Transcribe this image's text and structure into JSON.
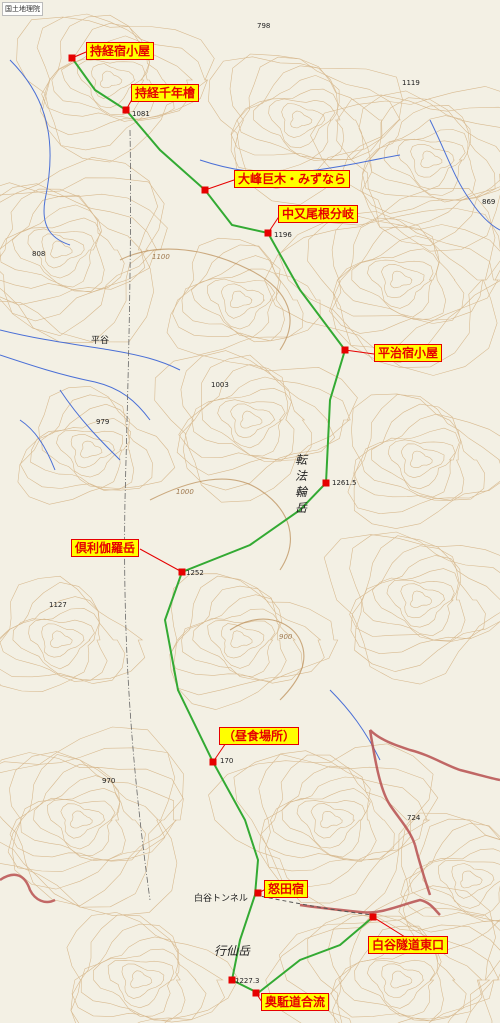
{
  "credit": "国土地理院",
  "waypoints": [
    {
      "name": "持経宿小屋"
    },
    {
      "name": "持経千年檜"
    },
    {
      "name": "大峰巨木・みずなら"
    },
    {
      "name": "中又尾根分岐"
    },
    {
      "name": "平治宿小屋"
    },
    {
      "name": "倶利伽羅岳"
    },
    {
      "name": "（昼食場所）"
    },
    {
      "name": "怒田宿"
    },
    {
      "name": "白谷隧道東口"
    },
    {
      "name": "奥駈道合流"
    }
  ],
  "elevations": [
    "798",
    "1119",
    "1081",
    "869",
    "1196",
    "808",
    "1003",
    "979",
    "1261.5",
    "1252",
    "1127",
    "170",
    "970",
    "724",
    "1227.3"
  ],
  "place_names": {
    "hirataani": "平谷",
    "tunnel": "白谷トンネル"
  },
  "mountains": {
    "tenporin": "転法輪岳",
    "gyosen": "行仙岳"
  },
  "contour_values": [
    "1100",
    "1000",
    "900"
  ],
  "colors": {
    "label_bg": "#ffff00",
    "label_text": "#e60000",
    "route": "#33aa33",
    "road": "#b85050",
    "stream": "#4a6fd6",
    "contour": "#c9a06a"
  }
}
